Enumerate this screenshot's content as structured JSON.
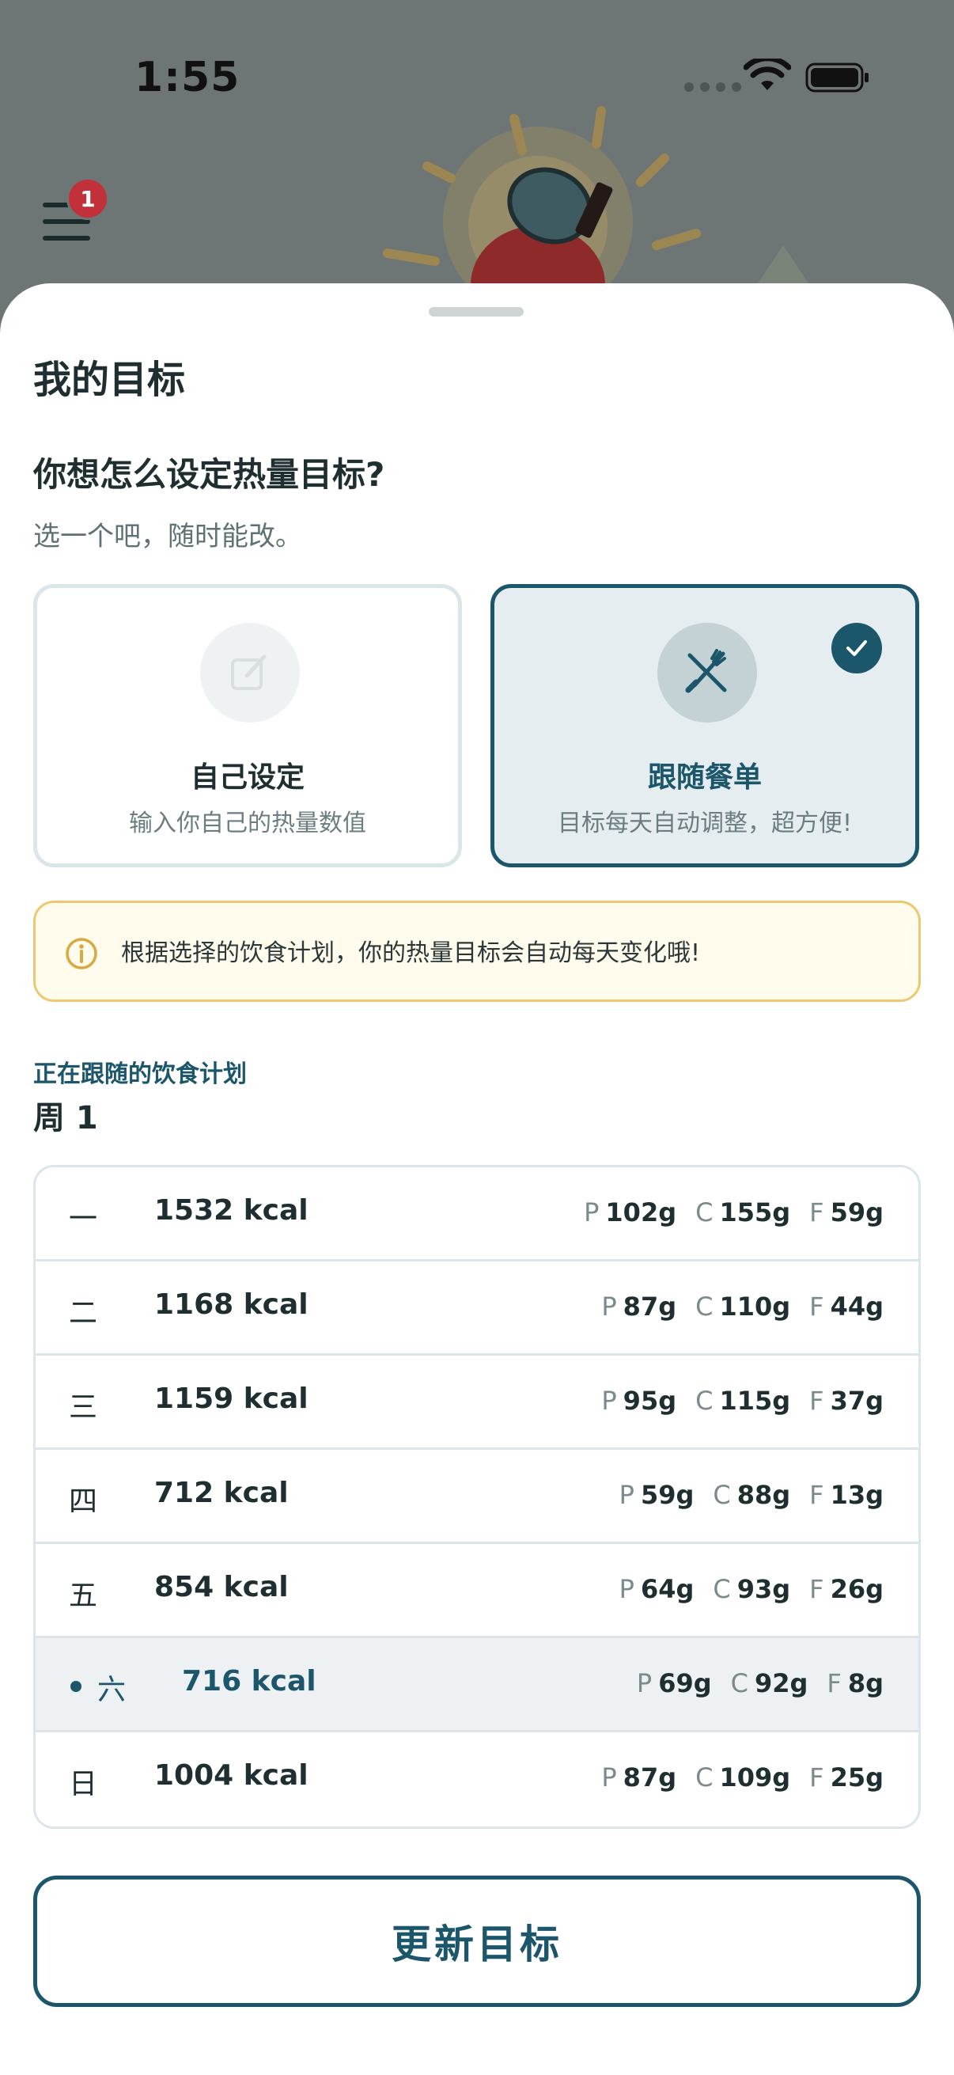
{
  "status": {
    "time": "1:55"
  },
  "header": {
    "badge_count": "1"
  },
  "sheet": {
    "title": "我的目标",
    "question": "你想怎么设定热量目标?",
    "subtitle": "选一个吧，随时能改。",
    "options": [
      {
        "label": "自己设定",
        "desc": "输入你自己的热量数值",
        "icon": "edit-icon",
        "selected": false
      },
      {
        "label": "跟随餐单",
        "desc": "目标每天自动调整，超方便!",
        "icon": "utensils-icon",
        "selected": true
      }
    ],
    "info": "根据选择的饮食计划，你的热量目标会自动每天变化哦!",
    "plan_caption": "正在跟随的饮食计划",
    "plan_week": "周 1",
    "days": [
      {
        "day": "一",
        "kcal": "1532 kcal",
        "p": "102g",
        "c": "155g",
        "f": "59g"
      },
      {
        "day": "二",
        "kcal": "1168 kcal",
        "p": "87g",
        "c": "110g",
        "f": "44g"
      },
      {
        "day": "三",
        "kcal": "1159 kcal",
        "p": "95g",
        "c": "115g",
        "f": "37g"
      },
      {
        "day": "四",
        "kcal": "712 kcal",
        "p": "59g",
        "c": "88g",
        "f": "13g"
      },
      {
        "day": "五",
        "kcal": "854 kcal",
        "p": "64g",
        "c": "93g",
        "f": "26g"
      },
      {
        "day": "六",
        "kcal": "716 kcal",
        "p": "69g",
        "c": "92g",
        "f": "8g"
      },
      {
        "day": "日",
        "kcal": "1004 kcal",
        "p": "87g",
        "c": "109g",
        "f": "25g"
      }
    ],
    "macro_labels": {
      "p": "P",
      "c": "C",
      "f": "F"
    },
    "update_button": "更新目标"
  },
  "colors": {
    "accent": "#1c566b",
    "badge": "#c2303a",
    "info_border": "#ecc870"
  }
}
